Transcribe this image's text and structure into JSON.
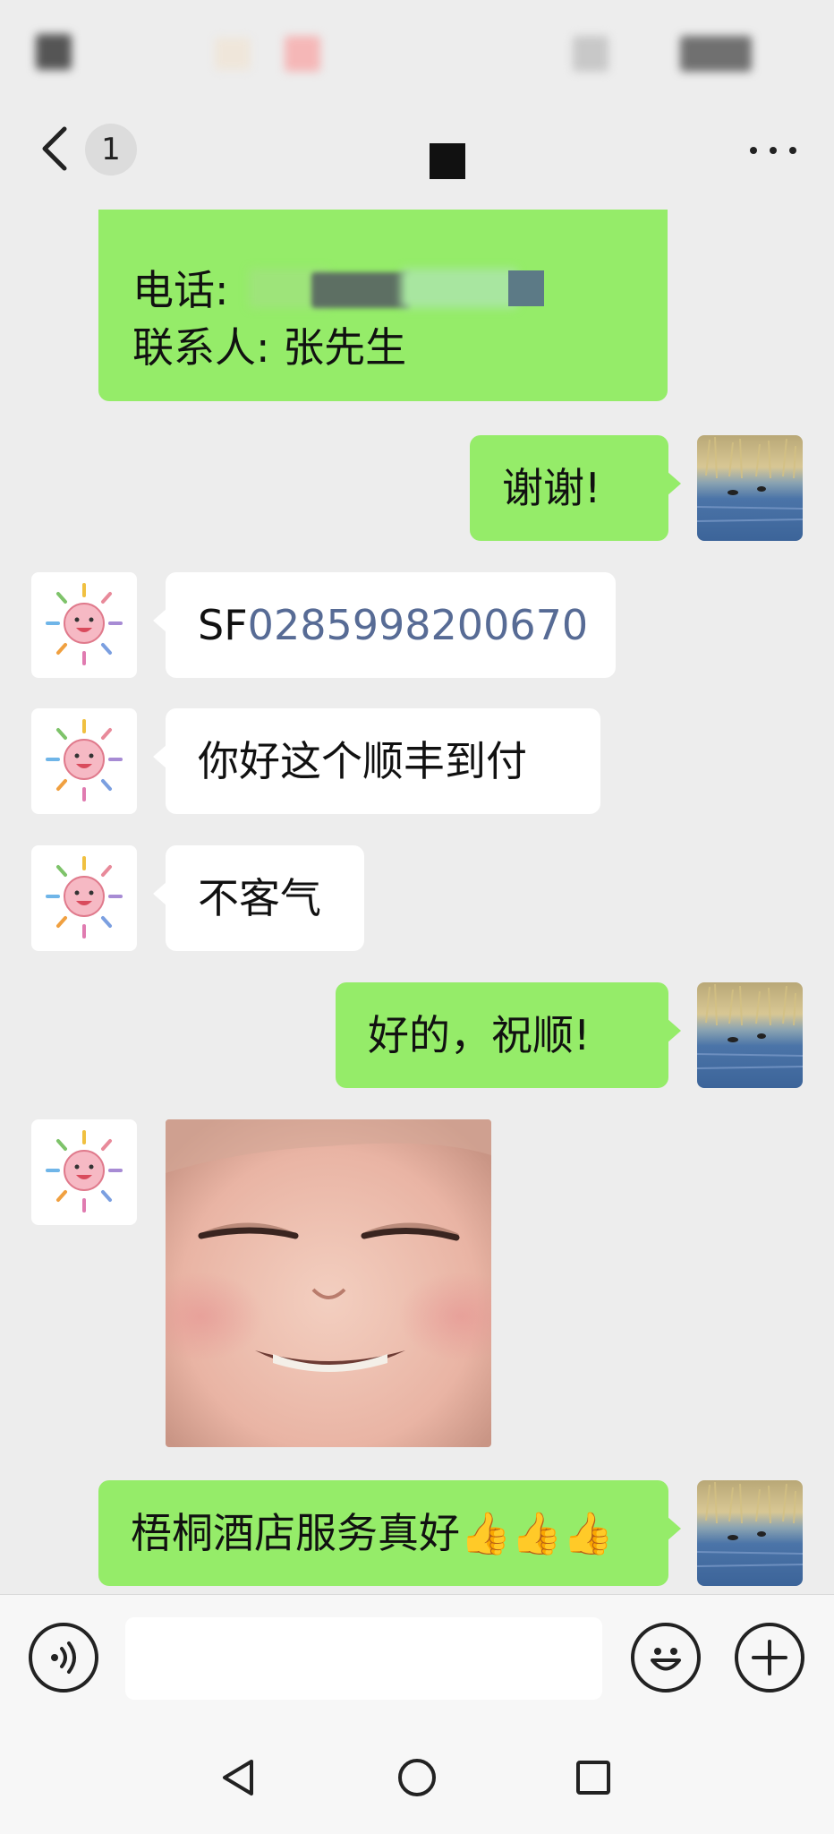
{
  "header": {
    "unread_count": "1"
  },
  "messages": [
    {
      "id": "m-info",
      "sender": "them",
      "type": "info",
      "phone_label": "电话:",
      "contact_line": "联系人:  张先生"
    },
    {
      "id": "m1",
      "sender": "me",
      "type": "text",
      "text": "谢谢!"
    },
    {
      "id": "m2",
      "sender": "them",
      "type": "tracking",
      "prefix": "SF",
      "number": "0285998200670"
    },
    {
      "id": "m3",
      "sender": "them",
      "type": "text",
      "text": "你好这个顺丰到付"
    },
    {
      "id": "m4",
      "sender": "them",
      "type": "text",
      "text": "不客气"
    },
    {
      "id": "m5",
      "sender": "me",
      "type": "text",
      "text": "好的，祝顺!"
    },
    {
      "id": "m6",
      "sender": "them",
      "type": "sticker"
    },
    {
      "id": "m7",
      "sender": "me",
      "type": "text",
      "text": "梧桐酒店服务真好👍👍👍"
    }
  ],
  "input_bar": {
    "input_value": "",
    "voice_icon": "voice-icon",
    "emoji_icon": "emoji-icon",
    "plus_icon": "plus-icon"
  },
  "nav": {
    "back_icon": "nav-back-icon",
    "home_icon": "nav-home-icon",
    "recents_icon": "nav-recents-icon"
  },
  "colors": {
    "background": "#ededed",
    "my_bubble": "#95ec69",
    "their_bubble": "#ffffff",
    "link": "#576b95"
  }
}
